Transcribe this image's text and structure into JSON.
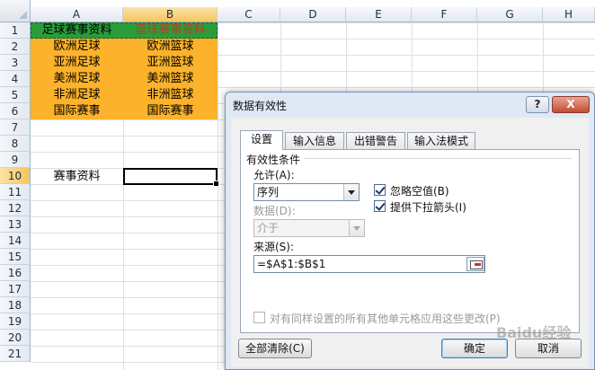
{
  "sheet": {
    "columns": [
      "A",
      "B",
      "C",
      "D",
      "E",
      "F",
      "G",
      "H"
    ],
    "rows": [
      "1",
      "2",
      "3",
      "4",
      "5",
      "6",
      "7",
      "8",
      "9",
      "10",
      "11",
      "12",
      "13",
      "14",
      "15",
      "16",
      "17",
      "18",
      "19",
      "20",
      "21"
    ],
    "colA": [
      "足球赛事资料",
      "欧洲足球",
      "亚洲足球",
      "美洲足球",
      "非洲足球",
      "国际赛事"
    ],
    "colB": [
      "篮球赛事资料",
      "欧洲篮球",
      "亚洲篮球",
      "美洲篮球",
      "非洲篮球",
      "国际赛事"
    ],
    "a10": "赛事资料",
    "colors": {
      "fill": "#fcb22a",
      "header_fill": "#2a9d3a",
      "header_b_text": "#c0392b"
    }
  },
  "dialog": {
    "title": "数据有效性",
    "help": "?",
    "close": "X",
    "tabs": [
      "设置",
      "输入信息",
      "出错警告",
      "输入法模式"
    ],
    "group_label": "有效性条件",
    "allow_label": "允许(A):",
    "allow_value": "序列",
    "ignore_blank": "忽略空值(B)",
    "in_cell_dropdown": "提供下拉箭头(I)",
    "data_label": "数据(D):",
    "data_value": "介于",
    "source_label": "来源(S):",
    "source_value": "=$A$1:$B$1",
    "apply_all": "对有同样设置的所有其他单元格应用这些更改(P)",
    "clear_all": "全部清除(C)",
    "ok": "确定",
    "cancel": "取消"
  },
  "watermark": "Baidu经验"
}
